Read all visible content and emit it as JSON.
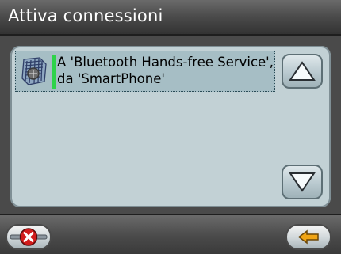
{
  "window": {
    "title": "Attiva connessioni"
  },
  "list": {
    "items": [
      {
        "label": "A 'Bluetooth Hands-free Service', da 'SmartPhone'",
        "icon": "bluetooth-device-icon",
        "status_color": "#2ed34a"
      }
    ]
  },
  "scroll": {
    "up_icon": "up-arrow-icon",
    "down_icon": "down-arrow-icon"
  },
  "bottom_bar": {
    "cancel_icon": "cancel-x-icon",
    "back_icon": "back-arrow-icon"
  }
}
